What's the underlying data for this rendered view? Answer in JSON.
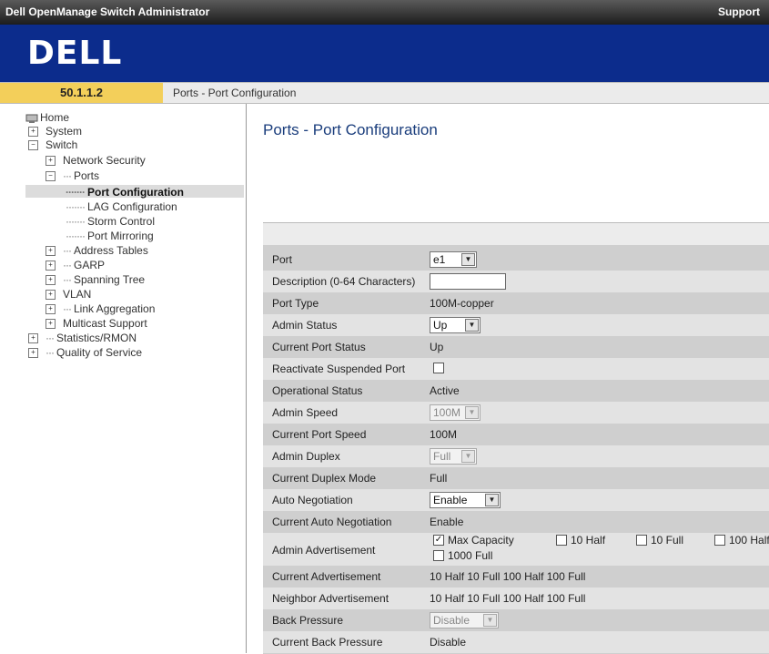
{
  "titlebar": {
    "title": "Dell OpenManage Switch Administrator",
    "support": "Support"
  },
  "banner": {
    "logo": "DELL"
  },
  "addrbar": {
    "ip": "50.1.1.2",
    "breadcrumb": "Ports - Port Configuration"
  },
  "tree": {
    "home": "Home",
    "system": "System",
    "switch": "Switch",
    "network_security": "Network Security",
    "ports": "Ports",
    "port_configuration": "Port Configuration",
    "lag_configuration": "LAG Configuration",
    "storm_control": "Storm Control",
    "port_mirroring": "Port Mirroring",
    "address_tables": "Address Tables",
    "garp": "GARP",
    "spanning_tree": "Spanning Tree",
    "vlan": "VLAN",
    "link_aggregation": "Link Aggregation",
    "multicast_support": "Multicast Support",
    "statistics_rmon": "Statistics/RMON",
    "quality_of_service": "Quality of Service"
  },
  "page": {
    "title": "Ports - Port Configuration"
  },
  "form": {
    "port": {
      "label": "Port",
      "value": "e1"
    },
    "description": {
      "label": "Description (0-64 Characters)",
      "value": ""
    },
    "port_type": {
      "label": "Port Type",
      "value": "100M-copper"
    },
    "admin_status": {
      "label": "Admin Status",
      "value": "Up"
    },
    "current_port_status": {
      "label": "Current Port Status",
      "value": "Up"
    },
    "reactivate": {
      "label": "Reactivate Suspended Port",
      "checked": false
    },
    "operational_status": {
      "label": "Operational Status",
      "value": "Active"
    },
    "admin_speed": {
      "label": "Admin Speed",
      "value": "100M"
    },
    "current_port_speed": {
      "label": "Current Port Speed",
      "value": "100M"
    },
    "admin_duplex": {
      "label": "Admin Duplex",
      "value": "Full"
    },
    "current_duplex": {
      "label": "Current Duplex Mode",
      "value": "Full"
    },
    "auto_negotiation": {
      "label": "Auto Negotiation",
      "value": "Enable"
    },
    "current_auto_negotiation": {
      "label": "Current Auto Negotiation",
      "value": "Enable"
    },
    "admin_advertisement": {
      "label": "Admin Advertisement",
      "options": [
        {
          "label": "Max Capacity",
          "checked": true
        },
        {
          "label": "10 Half",
          "checked": false
        },
        {
          "label": "10 Full",
          "checked": false
        },
        {
          "label": "100 Half",
          "checked": false
        },
        {
          "label": "1000 Full",
          "checked": false
        }
      ]
    },
    "current_advertisement": {
      "label": "Current Advertisement",
      "value": "10 Half 10 Full 100 Half 100 Full"
    },
    "neighbor_advertisement": {
      "label": "Neighbor Advertisement",
      "value": "10 Half 10 Full 100 Half 100 Full"
    },
    "back_pressure": {
      "label": "Back Pressure",
      "value": "Disable"
    },
    "current_back_pressure": {
      "label": "Current Back Pressure",
      "value": "Disable"
    }
  }
}
